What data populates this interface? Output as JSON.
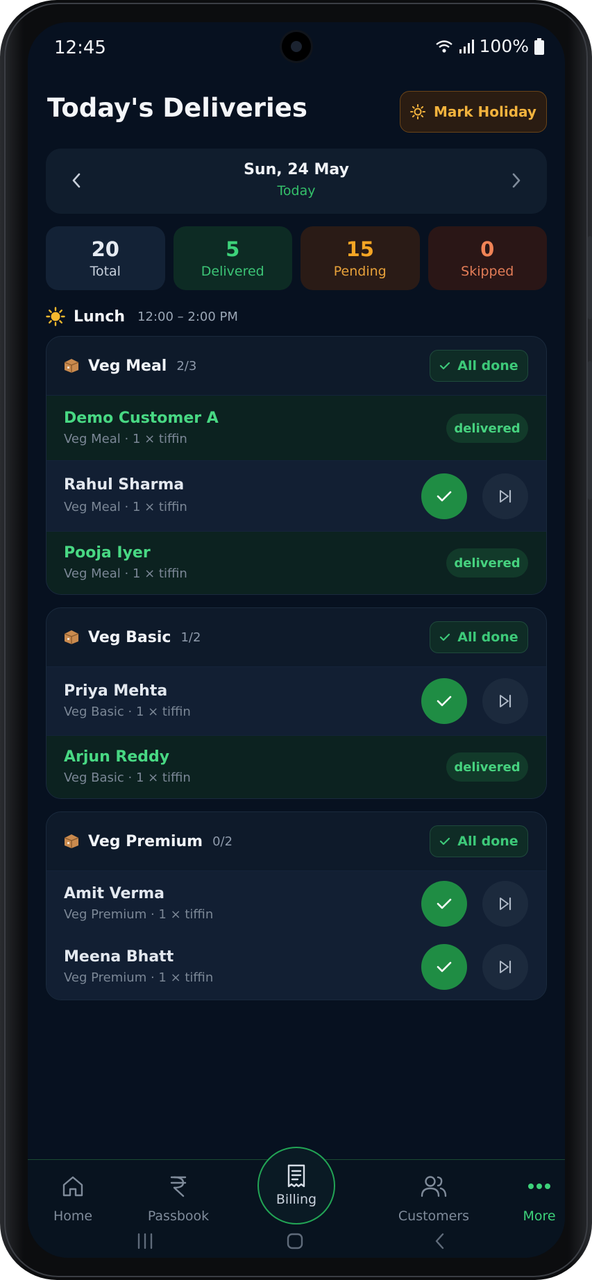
{
  "status_bar": {
    "time": "12:45",
    "battery": "100%"
  },
  "header": {
    "title": "Today's Deliveries",
    "holiday_button": "Mark Holiday"
  },
  "date_picker": {
    "date": "Sun, 24 May",
    "relative": "Today"
  },
  "stats": [
    {
      "value": "20",
      "label": "Total"
    },
    {
      "value": "5",
      "label": "Delivered"
    },
    {
      "value": "15",
      "label": "Pending"
    },
    {
      "value": "0",
      "label": "Skipped"
    }
  ],
  "meal": {
    "name": "Lunch",
    "time": "12:00 – 2:00 PM",
    "icon": "sun-icon"
  },
  "groups": [
    {
      "name": "Veg Meal",
      "count": "2/3",
      "done_label": "All done",
      "customers": [
        {
          "name": "Demo Customer A",
          "detail": "Veg Meal · 1 × tiffin",
          "status": "delivered"
        },
        {
          "name": "Rahul Sharma",
          "detail": "Veg Meal · 1 × tiffin",
          "status": "pending"
        },
        {
          "name": "Pooja Iyer",
          "detail": "Veg Meal · 1 × tiffin",
          "status": "delivered"
        }
      ]
    },
    {
      "name": "Veg Basic",
      "count": "1/2",
      "done_label": "All done",
      "customers": [
        {
          "name": "Priya Mehta",
          "detail": "Veg Basic · 1 × tiffin",
          "status": "pending"
        },
        {
          "name": "Arjun Reddy",
          "detail": "Veg Basic · 1 × tiffin",
          "status": "delivered"
        }
      ]
    },
    {
      "name": "Veg Premium",
      "count": "0/2",
      "done_label": "All done",
      "customers": [
        {
          "name": "Amit Verma",
          "detail": "Veg Premium · 1 × tiffin",
          "status": "pending"
        },
        {
          "name": "Meena Bhatt",
          "detail": "Veg Premium · 1 × tiffin",
          "status": "pending"
        }
      ]
    }
  ],
  "badge_label": "delivered",
  "bottom_nav": [
    {
      "label": "Home",
      "icon": "home-icon"
    },
    {
      "label": "Passbook",
      "icon": "rupee-icon"
    },
    {
      "label": "Billing",
      "icon": "receipt-icon"
    },
    {
      "label": "Customers",
      "icon": "users-icon"
    },
    {
      "label": "More",
      "icon": "more-dots-icon"
    }
  ],
  "colors": {
    "accent": "#3dd27a",
    "warning": "#f5a524",
    "danger": "#f08356",
    "background": "#071120"
  }
}
